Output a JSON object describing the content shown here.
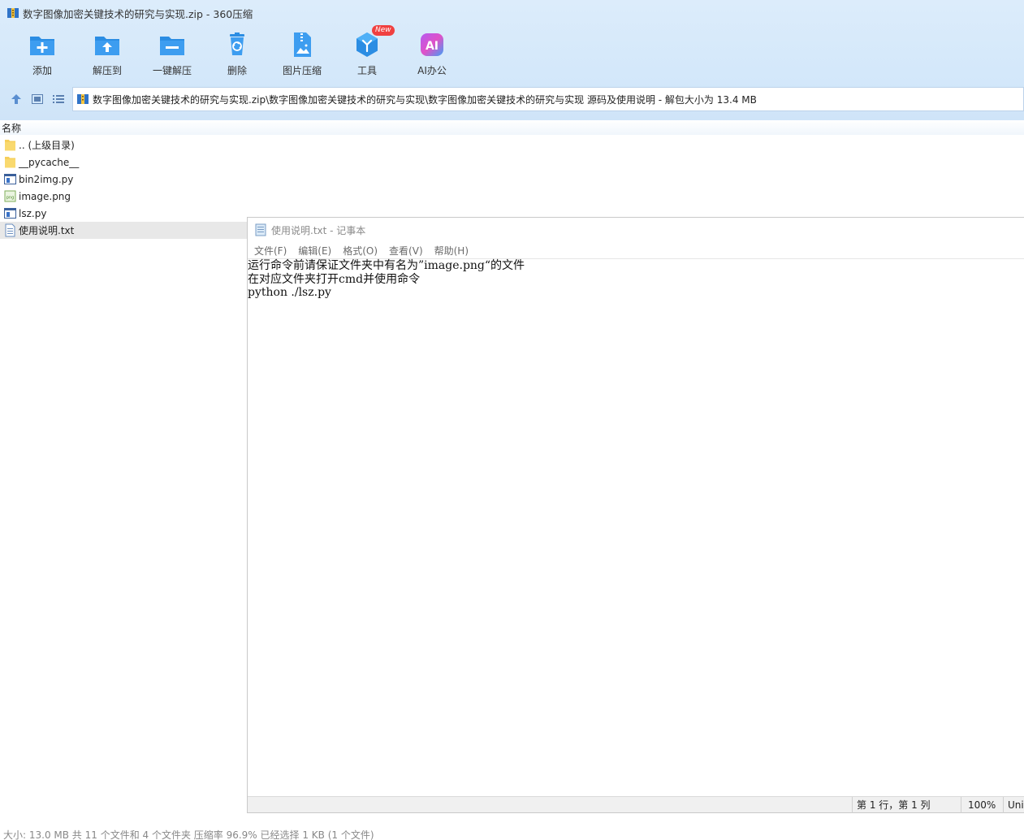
{
  "window": {
    "title": "数字图像加密关键技术的研究与实现.zip - 360压缩"
  },
  "toolbar": [
    {
      "label": "添加",
      "icon": "add-icon"
    },
    {
      "label": "解压到",
      "icon": "extract-to-icon"
    },
    {
      "label": "一键解压",
      "icon": "one-click-extract-icon"
    },
    {
      "label": "删除",
      "icon": "delete-icon"
    },
    {
      "label": "图片压缩",
      "icon": "image-compress-icon"
    },
    {
      "label": "工具",
      "icon": "tools-icon",
      "badge": "New"
    },
    {
      "label": "AI办公",
      "icon": "ai-office-icon"
    }
  ],
  "address": {
    "path": "数字图像加密关键技术的研究与实现.zip\\数字图像加密关键技术的研究与实现\\数字图像加密关键技术的研究与实现 源码及使用说明 - 解包大小为 13.4 MB"
  },
  "filelist": {
    "column_name": "名称",
    "items": [
      {
        "name": ".. (上级目录)",
        "type": "folder"
      },
      {
        "name": "__pycache__",
        "type": "folder"
      },
      {
        "name": "bin2img.py",
        "type": "py"
      },
      {
        "name": "image.png",
        "type": "png"
      },
      {
        "name": "lsz.py",
        "type": "py"
      },
      {
        "name": "使用说明.txt",
        "type": "txt",
        "selected": true
      }
    ]
  },
  "notepad": {
    "title": "使用说明.txt - 记事本",
    "menu": [
      "文件(F)",
      "编辑(E)",
      "格式(O)",
      "查看(V)",
      "帮助(H)"
    ],
    "lines": [
      "运行命令前请保证文件夹中有名为”image.png“的文件",
      "在对应文件夹打开cmd并使用命令",
      "python ./lsz.py"
    ],
    "status": {
      "position": "第 1 行，第 1 列",
      "zoom": "100%",
      "encoding": "Uni"
    }
  },
  "statusbar": {
    "text": "大小: 13.0 MB 共 11 个文件和 4 个文件夹 压缩率 96.9% 已经选择 1 KB (1 个文件)"
  },
  "colors": {
    "accent_blue": "#2b8de3",
    "badge_red": "#f04040",
    "folder_yellow": "#f6cf5b"
  }
}
